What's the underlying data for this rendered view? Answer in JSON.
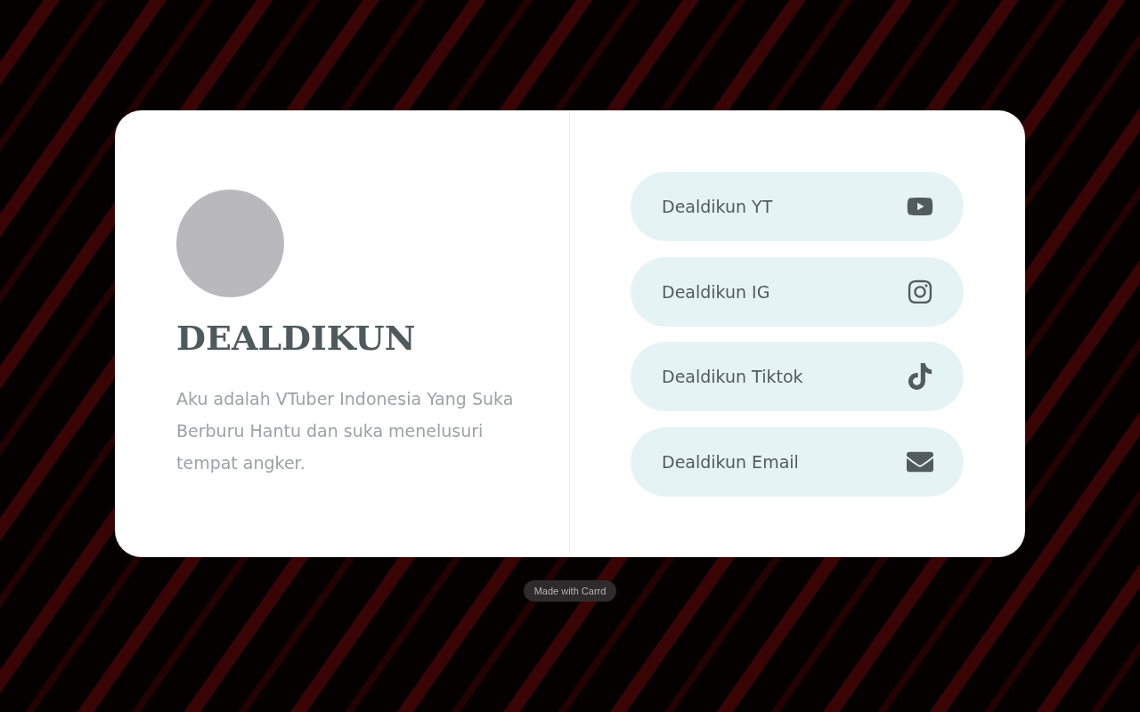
{
  "profile": {
    "name": "DEALDIKUN",
    "bio": "Aku adalah VTuber Indonesia Yang Suka Berburu Hantu dan suka menelusuri tempat angker."
  },
  "links": [
    {
      "label": "Dealdikun YT",
      "kind": "youtube"
    },
    {
      "label": "Dealdikun IG",
      "kind": "instagram"
    },
    {
      "label": "Dealdikun Tiktok",
      "kind": "tiktok"
    },
    {
      "label": "Dealdikun Email",
      "kind": "email"
    }
  ],
  "footer": {
    "badge": "Made with Carrd"
  }
}
